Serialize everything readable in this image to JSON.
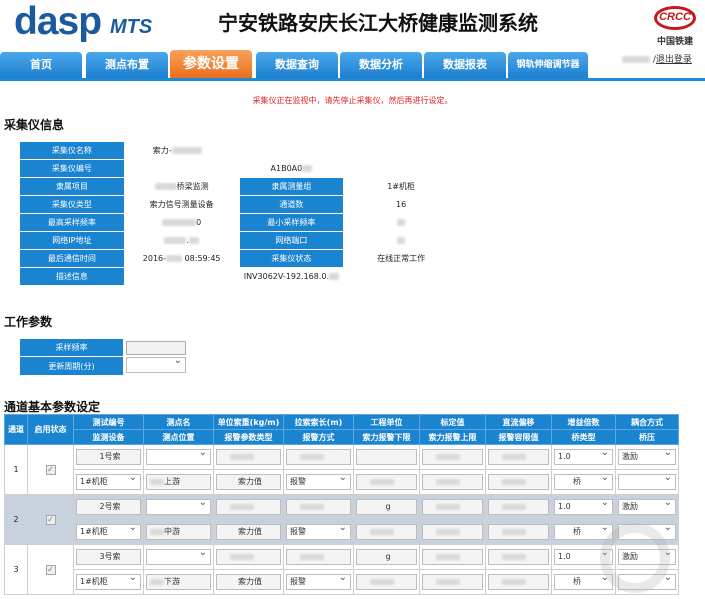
{
  "header": {
    "logo": "dasp",
    "logo_sub": "MTS",
    "title": "宁安铁路安庆长江大桥健康监测系统",
    "company_logo_text": "CRCC",
    "company_name": "中国铁建"
  },
  "nav": {
    "tabs": [
      {
        "label": "首页"
      },
      {
        "label": "测点布置"
      },
      {
        "label": "参数设置",
        "active": true
      },
      {
        "label": "数据查询"
      },
      {
        "label": "数据分析"
      },
      {
        "label": "数据报表"
      },
      {
        "label": "钢轨伸缩调节器"
      }
    ],
    "user_separator": "/",
    "logout": "退出登录"
  },
  "warning": "采集仪正在监视中，请先停止采集仪，然后再进行设定。",
  "collector": {
    "section_title": "采集仪信息",
    "name_label": "采集仪名称",
    "name_value": "索力-",
    "id_label": "采集仪编号",
    "id_value": "A1B0A0",
    "project_label": "隶属项目",
    "project_value": "桥梁监测",
    "group_label": "隶属测量组",
    "group_value": "1#机柜",
    "type_label": "采集仪类型",
    "type_value": "索力信号测量设备",
    "channels_label": "通道数",
    "channels_value": "16",
    "max_rate_label": "最高采样频率",
    "max_rate_value": "0",
    "min_rate_label": "最小采样频率",
    "min_rate_value": "",
    "ip_label": "网络IP地址",
    "ip_value": ".",
    "port_label": "网络端口",
    "port_value": "",
    "last_comm_label": "最后通信时间",
    "last_comm_value": "2016-",
    "last_comm_time": "08:59:45",
    "status_label": "采集仪状态",
    "status_value": "在线正常工作",
    "desc_label": "描述信息",
    "desc_value": "INV3062V-192.168.0."
  },
  "work": {
    "section_title": "工作参数",
    "rate_label": "采样频率",
    "period_label": "更新周期(分)"
  },
  "channels": {
    "section_title": "通道基本参数设定",
    "header1": [
      "通道",
      "启用状态",
      "测试编号",
      "测点名",
      "单位索重(kg/m)",
      "拉索索长(m)",
      "工程单位",
      "标定值",
      "直流偏移",
      "增益倍数",
      "耦合方式"
    ],
    "header2": [
      "监测设备",
      "测点位置",
      "报警参数类型",
      "报警方式",
      "索力报警下限",
      "索力报警上限",
      "报警容限值",
      "桥类型",
      "桥压"
    ],
    "rows": [
      {
        "ch": "1",
        "test_no": "1号索",
        "unit": "",
        "gain": "1.0",
        "coupling": "激励",
        "device": "1#机柜",
        "position": "上游",
        "alarm_type": "索力值",
        "alarm_mode": "报警",
        "bridge": "桥"
      },
      {
        "ch": "2",
        "test_no": "2号索",
        "unit": "g",
        "gain": "1.0",
        "coupling": "激励",
        "device": "1#机柜",
        "position": "中游",
        "alarm_type": "索力值",
        "alarm_mode": "报警",
        "bridge": "桥"
      },
      {
        "ch": "3",
        "test_no": "3号索",
        "unit": "g",
        "gain": "1.0",
        "coupling": "激励",
        "device": "1#机柜",
        "position": "下游",
        "alarm_type": "索力值",
        "alarm_mode": "报警",
        "bridge": "桥"
      }
    ]
  },
  "colors": {
    "primary": "#1a84d1",
    "active_tab": "#ec6e1e",
    "warning": "#e02020",
    "brand": "#c8161d"
  }
}
